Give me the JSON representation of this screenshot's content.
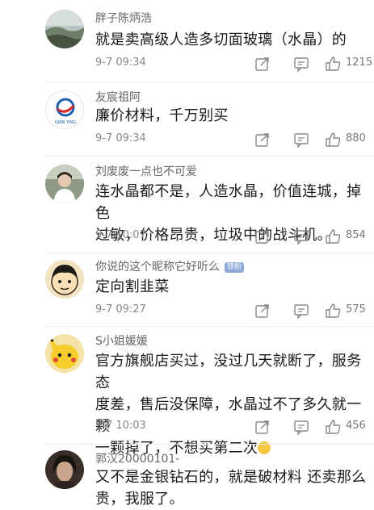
{
  "comments": [
    {
      "username": "胖子陈炳浩",
      "lines": [
        "就是卖高级人造多切面玻璃（水晶）的"
      ],
      "time": "9-7 09:34",
      "likes": "1215",
      "avatar": "landscape"
    },
    {
      "username": "友宸祖阿",
      "lines": [
        "廉价材料，千万别买"
      ],
      "time": "9-7 09:34",
      "likes": "880",
      "avatar": "logo"
    },
    {
      "username": "刘废废一点也不可爱",
      "lines": [
        "连水晶都不是，人造水晶，价值连城，掉色",
        "过敏，价格昂贵，垃圾中的战斗机。"
      ],
      "time": "9-7 10:07",
      "likes": "854",
      "avatar": "person"
    },
    {
      "username": "你说的这个昵称它好听么",
      "badge": "铁粉",
      "lines": [
        "定向割韭菜"
      ],
      "time": "9-7 09:27",
      "likes": "575",
      "avatar": "cartoon"
    },
    {
      "username": "S小姐媛媛",
      "lines": [
        "官方旗舰店买过，没过几天就断了，服务态",
        "度差，售后没保障，水晶过不了多久就一颗",
        "一颗掉了，不想买第二次"
      ],
      "time": "9-7 10:03",
      "likes": "456",
      "avatar": "pikachu"
    },
    {
      "username": "郭汉20000101-",
      "lines": [
        "又不是金银钻石的，就是破材料  还卖那么",
        "贵，我服了。"
      ],
      "time": "",
      "likes": "",
      "avatar": "dark"
    }
  ],
  "logo_text": "QIAN YING",
  "emoji": "slight-smile-emoji",
  "icons": {
    "share": "share-icon",
    "reply": "comment-icon",
    "like": "thumbs-up-icon"
  }
}
